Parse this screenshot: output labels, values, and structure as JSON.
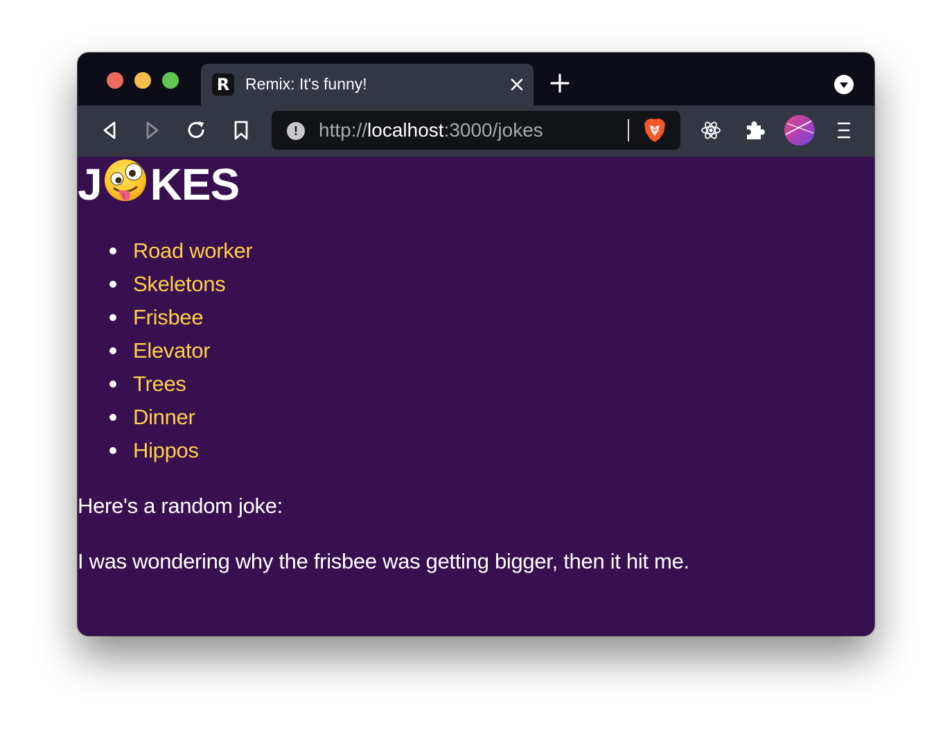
{
  "browser": {
    "tab": {
      "favicon": "remix-logo-icon",
      "favicon_letter": "R",
      "title": "Remix: It's funny!",
      "close_label": "×"
    },
    "new_tab_icon": "plus-icon",
    "tab_menu_icon": "chevron-down-icon",
    "toolbar": {
      "back_icon": "back-icon",
      "forward_icon": "forward-icon",
      "reload_icon": "reload-icon",
      "bookmark_icon": "bookmark-icon",
      "url_scheme": "http://",
      "url_host": "localhost",
      "url_rest": ":3000/jokes",
      "info_badge": "!",
      "shields_icon": "brave-shields-icon",
      "react_devtools_icon": "react-icon",
      "extensions_icon": "puzzle-icon",
      "profile_icon": "avatar",
      "menu_icon": "hamburger-icon"
    }
  },
  "page": {
    "title_left": "J",
    "title_right": "KES",
    "title_emoji": "zany-face-emoji",
    "jokes": [
      "Road worker",
      "Skeletons",
      "Frisbee",
      "Elevator",
      "Trees",
      "Dinner",
      "Hippos"
    ],
    "random_heading": "Here's a random joke:",
    "random_joke": "I was wondering why the frisbee was getting bigger, then it hit me."
  },
  "colors": {
    "page_background": "#380f4f",
    "link": "#ffd04b",
    "text": "#ffffff",
    "tabstrip": "#0c0d16",
    "toolbar": "#333744"
  }
}
